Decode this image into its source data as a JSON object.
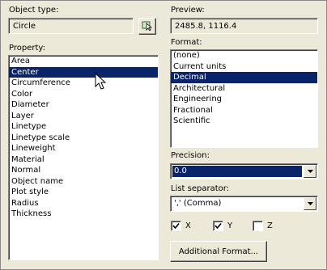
{
  "left": {
    "object_type_label": "Object type:",
    "object_type_value": "Circle",
    "select_objects_icon": "select-objects-icon",
    "property_label": "Property:",
    "properties": [
      "Area",
      "Center",
      "Circumference",
      "Color",
      "Diameter",
      "Layer",
      "Linetype",
      "Linetype scale",
      "Lineweight",
      "Material",
      "Normal",
      "Object name",
      "Plot style",
      "Radius",
      "Thickness"
    ],
    "selected_property": "Center"
  },
  "right": {
    "preview_label": "Preview:",
    "preview_value": "2485.8, 1116.4",
    "format_label": "Format:",
    "formats": [
      "(none)",
      "Current units",
      "Decimal",
      "Architectural",
      "Engineering",
      "Fractional",
      "Scientific"
    ],
    "selected_format": "Decimal",
    "precision_label": "Precision:",
    "precision_value": "0.0",
    "list_separator_label": "List separator:",
    "list_separator_value": "',' (Comma)",
    "checkboxes": [
      {
        "label": "X",
        "checked": true
      },
      {
        "label": "Y",
        "checked": true
      },
      {
        "label": "Z",
        "checked": false
      }
    ],
    "additional_format_button": "Additional Format..."
  },
  "colors": {
    "dialog_bg": "#ece9d8",
    "selection": "#0a246a",
    "selection_text": "#ffffff"
  }
}
